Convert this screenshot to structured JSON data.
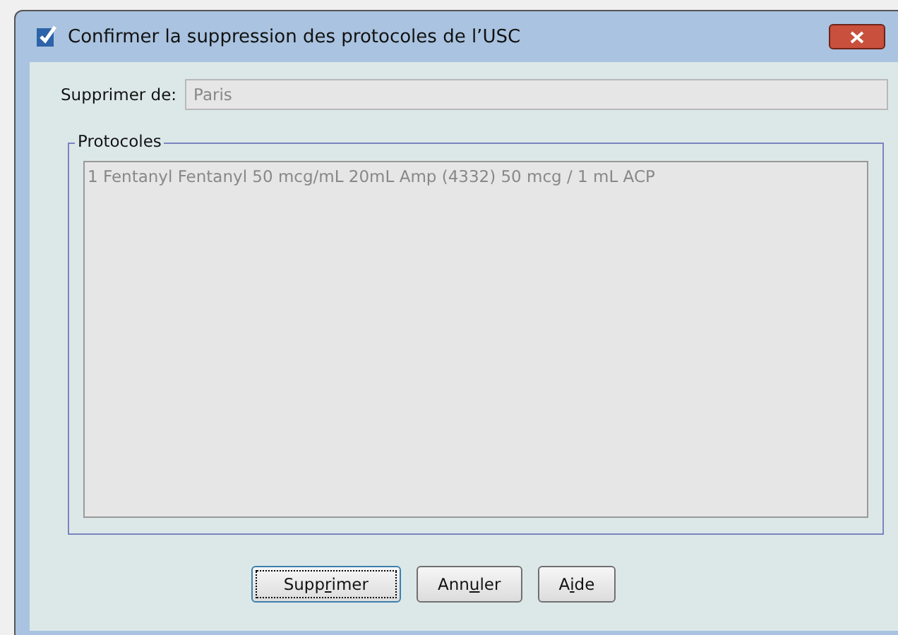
{
  "window": {
    "title": "Confirmer la suppression des protocoles de l’USC"
  },
  "delete_from": {
    "label": "Supprimer de:",
    "value": "Paris",
    "disabled": true
  },
  "protocols": {
    "legend": "Protocoles",
    "items": [
      "1 Fentanyl Fentanyl 50 mcg/mL 20mL Amp (4332) 50 mcg / 1 mL ACP"
    ]
  },
  "buttons": [
    {
      "label_before": "Supp",
      "mnemonic": "r",
      "label_after": "imer",
      "default": true
    },
    {
      "label_before": "Ann",
      "mnemonic": "u",
      "label_after": "ler",
      "default": false
    },
    {
      "label_before": "A",
      "mnemonic": "i",
      "label_after": "de",
      "default": false
    }
  ]
}
